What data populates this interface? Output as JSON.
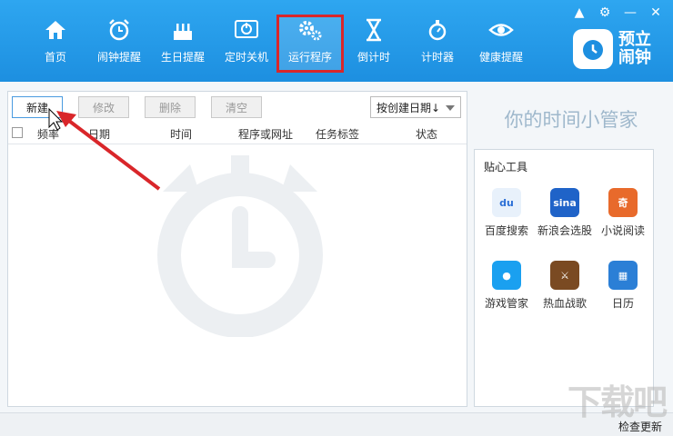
{
  "nav": {
    "items": [
      {
        "label": "首页",
        "icon": "home-icon"
      },
      {
        "label": "闹钟提醒",
        "icon": "alarm-clock-icon"
      },
      {
        "label": "生日提醒",
        "icon": "birthday-cake-icon"
      },
      {
        "label": "定时关机",
        "icon": "power-icon"
      },
      {
        "label": "运行程序",
        "icon": "gears-icon"
      },
      {
        "label": "倒计时",
        "icon": "hourglass-icon"
      },
      {
        "label": "计时器",
        "icon": "stopwatch-icon"
      },
      {
        "label": "健康提醒",
        "icon": "eye-icon"
      }
    ],
    "active_index": 4
  },
  "logo": {
    "text_line1": "预立",
    "text_line2": "闹钟"
  },
  "toolbar": {
    "new_label": "新建",
    "edit_label": "修改",
    "delete_label": "删除",
    "clear_label": "清空",
    "sort_label": "按创建日期↓"
  },
  "table": {
    "headers": [
      "频率",
      "日期",
      "时间",
      "程序或网址",
      "任务标签",
      "状态"
    ]
  },
  "slogan": "你的时间小管家",
  "tools": {
    "title": "贴心工具",
    "items": [
      {
        "label": "百度搜索",
        "icon": "baidu-icon",
        "color": "#e8f1fb"
      },
      {
        "label": "新浪会选股",
        "icon": "sina-icon",
        "color": "#1f63c8"
      },
      {
        "label": "小说阅读",
        "icon": "novel-icon",
        "color": "#e86a2b"
      },
      {
        "label": "游戏管家",
        "icon": "game-bag-icon",
        "color": "#1aa0f0"
      },
      {
        "label": "热血战歌",
        "icon": "game-warrior-icon",
        "color": "#7a4a22"
      },
      {
        "label": "日历",
        "icon": "calendar-icon",
        "color": "#2b7fd6"
      }
    ]
  },
  "status": {
    "check_update": "检查更新"
  },
  "watermark": "下载吧",
  "colors": {
    "brand": "#1d8fe0",
    "highlight": "#d9262a"
  }
}
